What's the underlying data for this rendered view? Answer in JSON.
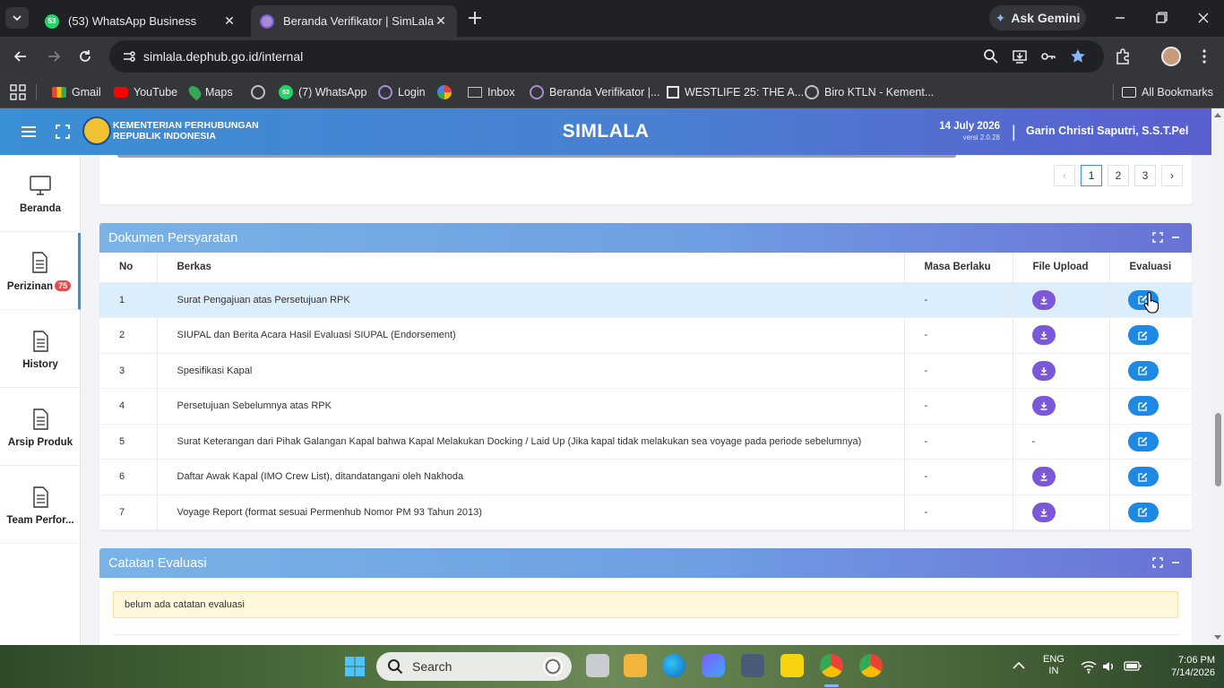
{
  "browser": {
    "tabs": [
      {
        "label": "(53) WhatsApp Business",
        "icon": "whatsapp-icon",
        "badge": "53"
      },
      {
        "label": "Beranda Verifikator | SimLala",
        "icon": "simlala-icon"
      }
    ],
    "ask_gemini": "Ask Gemini",
    "url": "simlala.dephub.go.id/internal",
    "bookmarks": [
      {
        "label": "Gmail",
        "icon": "gmail-icon"
      },
      {
        "label": "YouTube",
        "icon": "youtube-icon"
      },
      {
        "label": "Maps",
        "icon": "maps-icon"
      },
      {
        "label": "",
        "icon": "globe-icon"
      },
      {
        "label": "(7) WhatsApp",
        "icon": "whatsapp-icon",
        "badge": "53"
      },
      {
        "label": "Login",
        "icon": "simlala-icon"
      },
      {
        "label": "",
        "icon": "pinwheel-icon"
      },
      {
        "label": "Inbox",
        "icon": "mail-icon"
      },
      {
        "label": "Beranda Verifikator |...",
        "icon": "simlala-icon"
      },
      {
        "label": "WESTLIFE 25: THE A...",
        "icon": "bookmark-page-icon"
      },
      {
        "label": "Biro KTLN - Kement...",
        "icon": "globe-icon"
      }
    ],
    "all_bookmarks": "All Bookmarks"
  },
  "header": {
    "ministry_line1": "KEMENTERIAN PERHUBUNGAN",
    "ministry_line2": "REPUBLIK INDONESIA",
    "app_title": "SIMLALA",
    "date": "14 July 2026",
    "version": "versi 2.0.28",
    "separator": "|",
    "user": "Garin Christi Saputri, S.S.T.Pel"
  },
  "sidebar": {
    "items": [
      {
        "label": "Beranda",
        "icon": "monitor-icon"
      },
      {
        "label": "Perizinan",
        "icon": "document-icon",
        "badge": "75",
        "active": true
      },
      {
        "label": "History",
        "icon": "document-icon"
      },
      {
        "label": "Arsip Produk",
        "icon": "document-icon"
      },
      {
        "label": "Team Perfor...",
        "icon": "document-icon"
      }
    ]
  },
  "pagination": {
    "prev": "‹",
    "pages": [
      "1",
      "2",
      "3"
    ],
    "current": "1",
    "next": "›"
  },
  "dokumen": {
    "title": "Dokumen Persyaratan",
    "columns": {
      "no": "No",
      "berkas": "Berkas",
      "masa": "Masa Berlaku",
      "file": "File Upload",
      "evaluasi": "Evaluasi"
    },
    "rows": [
      {
        "no": "1",
        "berkas": "Surat Pengajuan atas Persetujuan RPK",
        "masa": "-",
        "file": true,
        "file_text": "",
        "highlight": true
      },
      {
        "no": "2",
        "berkas": "SIUPAL dan Berita Acara Hasil Evaluasi SIUPAL (Endorsement)",
        "masa": "-",
        "file": true,
        "file_text": ""
      },
      {
        "no": "3",
        "berkas": "Spesifikasi Kapal",
        "masa": "-",
        "file": true,
        "file_text": ""
      },
      {
        "no": "4",
        "berkas": "Persetujuan Sebelumnya atas RPK",
        "masa": "-",
        "file": true,
        "file_text": ""
      },
      {
        "no": "5",
        "berkas": "Surat Keterangan dari Pihak Galangan Kapal bahwa Kapal Melakukan Docking / Laid Up (Jika kapal tidak melakukan sea voyage pada periode sebelumnya)",
        "masa": "-",
        "file": false,
        "file_text": "-"
      },
      {
        "no": "6",
        "berkas": "Daftar Awak Kapal (IMO Crew List), ditandatangani oleh Nakhoda",
        "masa": "-",
        "file": true,
        "file_text": ""
      },
      {
        "no": "7",
        "berkas": "Voyage Report (format sesuai Permenhub Nomor PM 93 Tahun 2013)",
        "masa": "-",
        "file": true,
        "file_text": ""
      }
    ]
  },
  "catatan": {
    "title": "Catatan Evaluasi",
    "note": "belum ada catatan evaluasi"
  },
  "taskbar": {
    "search": "Search",
    "lang1": "ENG",
    "lang2": "IN",
    "time": "7:06 PM",
    "date": "7/14/2026"
  },
  "colors": {
    "header_start": "#3b8fd4",
    "header_end": "#5b5ecf",
    "download_button": "#7c57d6",
    "evaluate_button": "#1e88e5",
    "badge": "#e84b4b",
    "row_highlight": "#dcedfb"
  }
}
